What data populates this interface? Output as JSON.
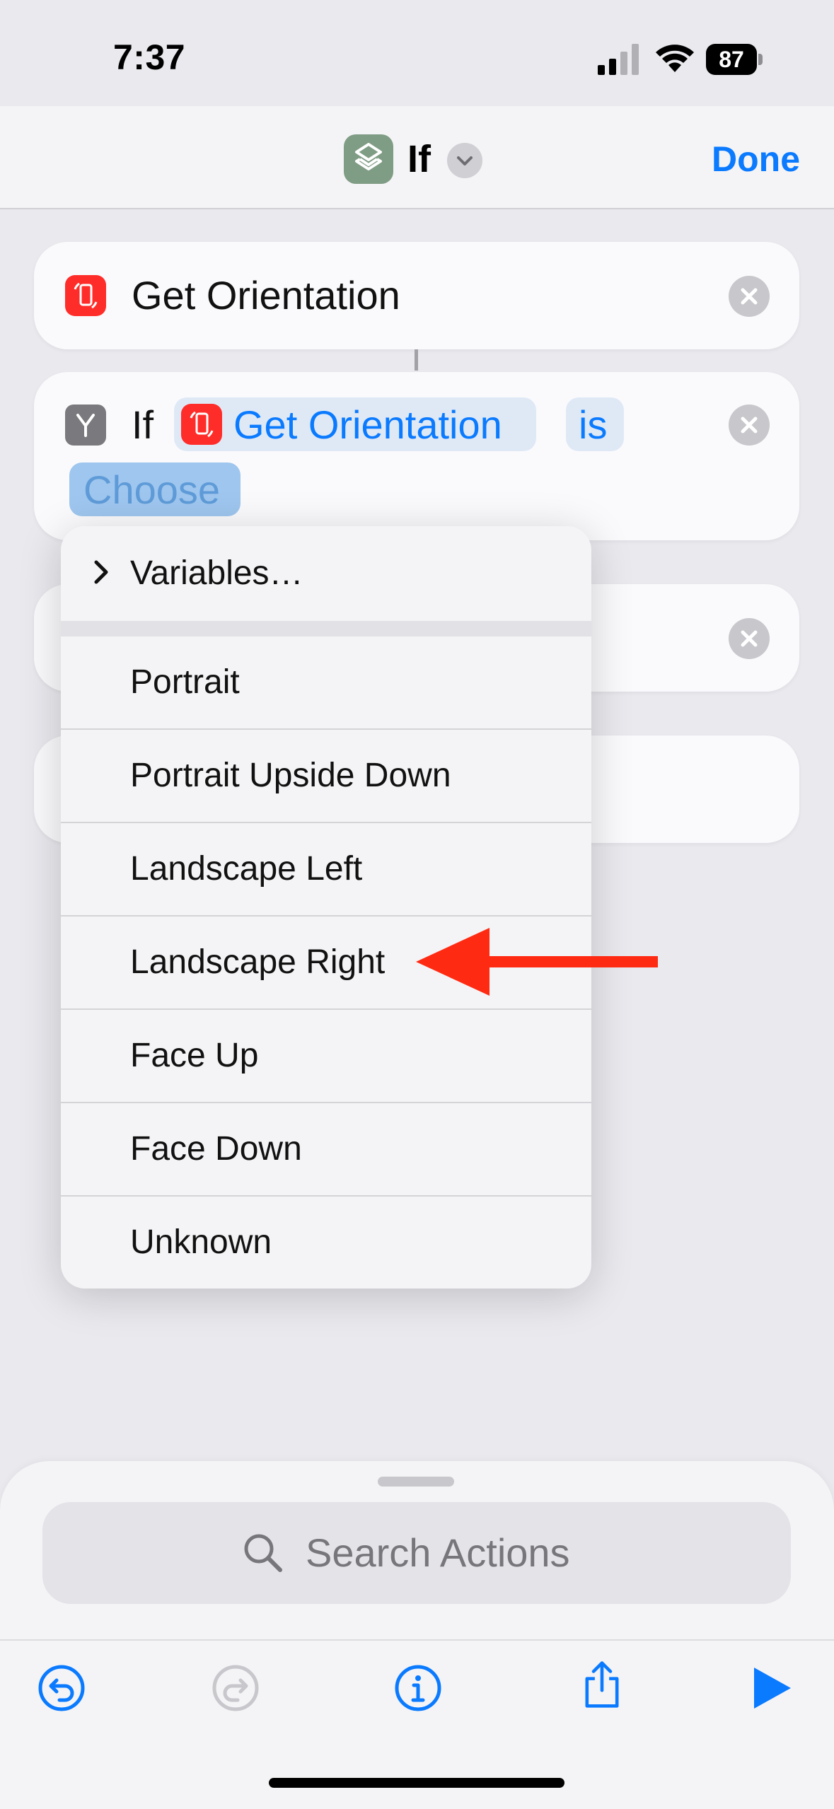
{
  "status_bar": {
    "time": "7:37",
    "battery": "87"
  },
  "nav": {
    "title": "If",
    "done_label": "Done"
  },
  "actions": {
    "get_orientation": {
      "title": "Get Orientation"
    },
    "if_block": {
      "keyword": "If",
      "variable": "Get Orientation",
      "operator": "is",
      "value_placeholder": "Choose"
    }
  },
  "menu": {
    "variables_label": "Variables…",
    "options": [
      "Portrait",
      "Portrait Upside Down",
      "Landscape Left",
      "Landscape Right",
      "Face Up",
      "Face Down",
      "Unknown"
    ]
  },
  "search": {
    "placeholder": "Search Actions"
  },
  "toolbar": {
    "items": [
      "undo-icon",
      "redo-icon",
      "info-icon",
      "share-icon",
      "play-icon"
    ]
  },
  "colors": {
    "accent": "#0a7aff",
    "arrow": "#ff2a12",
    "action_icon": "#ff2d2a"
  }
}
